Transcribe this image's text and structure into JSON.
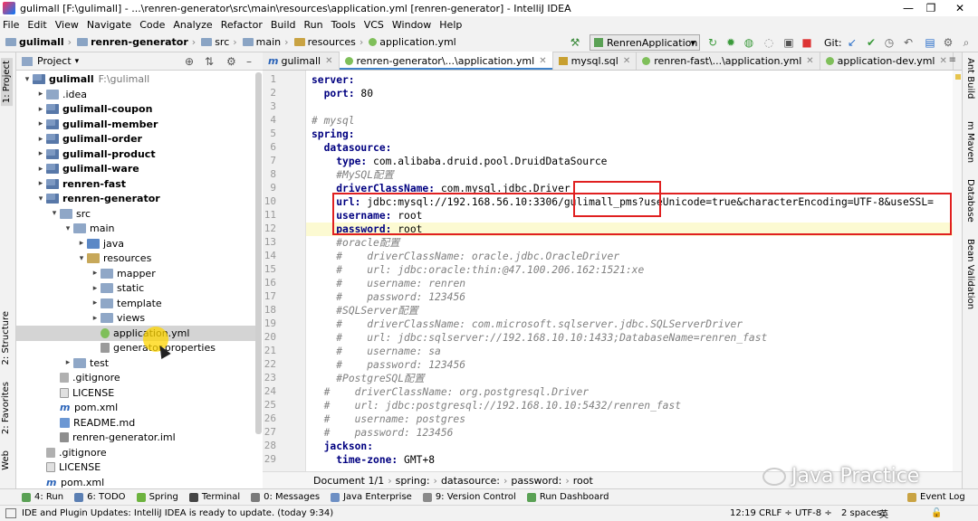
{
  "window": {
    "title": "gulimall [F:\\gulimall] - ...\\renren-generator\\src\\main\\resources\\application.yml [renren-generator] - IntelliJ IDEA",
    "controls": [
      "—",
      "❐",
      "✕"
    ]
  },
  "menu": [
    "File",
    "Edit",
    "View",
    "Navigate",
    "Code",
    "Analyze",
    "Refactor",
    "Build",
    "Run",
    "Tools",
    "VCS",
    "Window",
    "Help"
  ],
  "nav": {
    "crumbs": [
      "gulimall",
      "renren-generator",
      "src",
      "main",
      "resources",
      "application.yml"
    ],
    "run_config": "RenrenApplication",
    "git_label": "Git:"
  },
  "left_tabs": [
    "1: Project",
    "2: Structure",
    "2: Favorites",
    "Web"
  ],
  "right_tabs": [
    "Ant Build",
    "m Maven",
    "Database",
    "Bean Validation"
  ],
  "project": {
    "header": "Project",
    "tree": [
      {
        "label": "gulimall",
        "suffix": "F:\\gulimall",
        "depth": 0,
        "arrow": "▾",
        "icon": "mod",
        "bold": true
      },
      {
        "label": ".idea",
        "depth": 1,
        "arrow": "▸",
        "icon": "dir"
      },
      {
        "label": "gulimall-coupon",
        "depth": 1,
        "arrow": "▸",
        "icon": "mod",
        "bold": true
      },
      {
        "label": "gulimall-member",
        "depth": 1,
        "arrow": "▸",
        "icon": "mod",
        "bold": true
      },
      {
        "label": "gulimall-order",
        "depth": 1,
        "arrow": "▸",
        "icon": "mod",
        "bold": true
      },
      {
        "label": "gulimall-product",
        "depth": 1,
        "arrow": "▸",
        "icon": "mod",
        "bold": true
      },
      {
        "label": "gulimall-ware",
        "depth": 1,
        "arrow": "▸",
        "icon": "mod",
        "bold": true
      },
      {
        "label": "renren-fast",
        "depth": 1,
        "arrow": "▸",
        "icon": "mod",
        "bold": true
      },
      {
        "label": "renren-generator",
        "depth": 1,
        "arrow": "▾",
        "icon": "mod",
        "bold": true
      },
      {
        "label": "src",
        "depth": 2,
        "arrow": "▾",
        "icon": "dir"
      },
      {
        "label": "main",
        "depth": 3,
        "arrow": "▾",
        "icon": "dir"
      },
      {
        "label": "java",
        "depth": 4,
        "arrow": "▸",
        "icon": "srcd"
      },
      {
        "label": "resources",
        "depth": 4,
        "arrow": "▾",
        "icon": "resd"
      },
      {
        "label": "mapper",
        "depth": 5,
        "arrow": "▸",
        "icon": "dir"
      },
      {
        "label": "static",
        "depth": 5,
        "arrow": "▸",
        "icon": "dir"
      },
      {
        "label": "template",
        "depth": 5,
        "arrow": "▸",
        "icon": "dir"
      },
      {
        "label": "views",
        "depth": 5,
        "arrow": "▸",
        "icon": "dir"
      },
      {
        "label": "application.yml",
        "depth": 5,
        "arrow": "",
        "icon": "yml",
        "selected": true
      },
      {
        "label": "generator.properties",
        "depth": 5,
        "arrow": "",
        "icon": "prop"
      },
      {
        "label": "test",
        "depth": 3,
        "arrow": "▸",
        "icon": "dir"
      },
      {
        "label": ".gitignore",
        "depth": 2,
        "arrow": "",
        "icon": "git"
      },
      {
        "label": "LICENSE",
        "depth": 2,
        "arrow": "",
        "icon": "txt"
      },
      {
        "label": "pom.xml",
        "depth": 2,
        "arrow": "",
        "icon": "mvn"
      },
      {
        "label": "README.md",
        "depth": 2,
        "arrow": "",
        "icon": "md"
      },
      {
        "label": "renren-generator.iml",
        "depth": 2,
        "arrow": "",
        "icon": "iml"
      },
      {
        "label": ".gitignore",
        "depth": 1,
        "arrow": "",
        "icon": "git"
      },
      {
        "label": "LICENSE",
        "depth": 1,
        "arrow": "",
        "icon": "txt"
      },
      {
        "label": "pom.xml",
        "depth": 1,
        "arrow": "",
        "icon": "mvn"
      }
    ]
  },
  "editor_tabs": [
    {
      "label": "gulimall",
      "icon": "m",
      "active": false
    },
    {
      "label": "renren-generator\\...\\application.yml",
      "active": true
    },
    {
      "label": "mysql.sql",
      "active": false
    },
    {
      "label": "renren-fast\\...\\application.yml",
      "active": false
    },
    {
      "label": "application-dev.yml",
      "active": false
    }
  ],
  "editor": {
    "lines": [
      {
        "n": "1",
        "segs": [
          [
            "k",
            "server:"
          ]
        ]
      },
      {
        "n": "2",
        "segs": [
          [
            "v",
            "  "
          ],
          [
            "k",
            "port:"
          ],
          [
            "v",
            " 80"
          ]
        ]
      },
      {
        "n": "3",
        "segs": [
          [
            "v",
            ""
          ]
        ]
      },
      {
        "n": "4",
        "segs": [
          [
            "cm",
            "# mysql"
          ]
        ]
      },
      {
        "n": "5",
        "segs": [
          [
            "k",
            "spring:"
          ]
        ]
      },
      {
        "n": "6",
        "segs": [
          [
            "v",
            "  "
          ],
          [
            "k",
            "datasource:"
          ]
        ]
      },
      {
        "n": "7",
        "segs": [
          [
            "v",
            "    "
          ],
          [
            "k",
            "type:"
          ],
          [
            "v",
            " com.alibaba.druid.pool.DruidDataSource"
          ]
        ]
      },
      {
        "n": "8",
        "segs": [
          [
            "v",
            "    "
          ],
          [
            "cm",
            "#MySQL配置"
          ]
        ]
      },
      {
        "n": "9",
        "segs": [
          [
            "v",
            "    "
          ],
          [
            "k",
            "driverClassName:"
          ],
          [
            "v",
            " com.mysql.jdbc.Driver"
          ]
        ]
      },
      {
        "n": "10",
        "segs": [
          [
            "v",
            "    "
          ],
          [
            "k",
            "url:"
          ],
          [
            "v",
            " jdbc:mysql://192.168.56.10:3306/gulimall_pms?useUnicode=true&characterEncoding=UTF-8&useSSL="
          ]
        ]
      },
      {
        "n": "11",
        "segs": [
          [
            "v",
            "    "
          ],
          [
            "k",
            "username:"
          ],
          [
            "v",
            " root"
          ]
        ]
      },
      {
        "n": "12",
        "segs": [
          [
            "v",
            "    "
          ],
          [
            "k",
            "password:"
          ],
          [
            "v",
            " root"
          ]
        ],
        "hl": true
      },
      {
        "n": "13",
        "segs": [
          [
            "v",
            "    "
          ],
          [
            "cm",
            "#oracle配置"
          ]
        ]
      },
      {
        "n": "14",
        "segs": [
          [
            "v",
            "    "
          ],
          [
            "cm",
            "#    driverClassName: oracle.jdbc.OracleDriver"
          ]
        ]
      },
      {
        "n": "15",
        "segs": [
          [
            "v",
            "    "
          ],
          [
            "cm",
            "#    url: jdbc:oracle:thin:@47.100.206.162:1521:xe"
          ]
        ]
      },
      {
        "n": "16",
        "segs": [
          [
            "v",
            "    "
          ],
          [
            "cm",
            "#    username: renren"
          ]
        ]
      },
      {
        "n": "17",
        "segs": [
          [
            "v",
            "    "
          ],
          [
            "cm",
            "#    password: 123456"
          ]
        ]
      },
      {
        "n": "18",
        "segs": [
          [
            "v",
            "    "
          ],
          [
            "cm",
            "#SQLServer配置"
          ]
        ]
      },
      {
        "n": "19",
        "segs": [
          [
            "v",
            "    "
          ],
          [
            "cm",
            "#    driverClassName: com.microsoft.sqlserver.jdbc.SQLServerDriver"
          ]
        ]
      },
      {
        "n": "20",
        "segs": [
          [
            "v",
            "    "
          ],
          [
            "cm",
            "#    url: jdbc:sqlserver://192.168.10.10:1433;DatabaseName=renren_fast"
          ]
        ]
      },
      {
        "n": "21",
        "segs": [
          [
            "v",
            "    "
          ],
          [
            "cm",
            "#    username: sa"
          ]
        ]
      },
      {
        "n": "22",
        "segs": [
          [
            "v",
            "    "
          ],
          [
            "cm",
            "#    password: 123456"
          ]
        ]
      },
      {
        "n": "23",
        "segs": [
          [
            "v",
            "    "
          ],
          [
            "cm",
            "#PostgreSQL配置"
          ]
        ]
      },
      {
        "n": "24",
        "segs": [
          [
            "v",
            "  "
          ],
          [
            "cm",
            "#    driverClassName: org.postgresql.Driver"
          ]
        ]
      },
      {
        "n": "25",
        "segs": [
          [
            "v",
            "  "
          ],
          [
            "cm",
            "#    url: jdbc:postgresql://192.168.10.10:5432/renren_fast"
          ]
        ]
      },
      {
        "n": "26",
        "segs": [
          [
            "v",
            "  "
          ],
          [
            "cm",
            "#    username: postgres"
          ]
        ]
      },
      {
        "n": "27",
        "segs": [
          [
            "v",
            "  "
          ],
          [
            "cm",
            "#    password: 123456"
          ]
        ]
      },
      {
        "n": "28",
        "segs": [
          [
            "v",
            "  "
          ],
          [
            "k",
            "jackson:"
          ]
        ]
      },
      {
        "n": "29",
        "segs": [
          [
            "v",
            "    "
          ],
          [
            "k",
            "time-zone:"
          ],
          [
            "v",
            " GMT+8"
          ]
        ]
      }
    ],
    "breadcrumb": [
      "Document 1/1",
      "spring:",
      "datasource:",
      "password:",
      "root"
    ]
  },
  "tool_windows": [
    "4: Run",
    "6: TODO",
    "Spring",
    "Terminal",
    "0: Messages",
    "Java Enterprise",
    "9: Version Control",
    "Run Dashboard",
    "Event Log"
  ],
  "status": {
    "message": "IDE and Plugin Updates: IntelliJ IDEA is ready to update. (today 9:34)",
    "position": "12:19",
    "line_sep": "CRLF ÷",
    "encoding": "UTF-8 ÷",
    "indent": "2 spaces",
    "ime": "英"
  },
  "watermark": "Java Practice",
  "colors": {
    "selection": "#d4d4d4",
    "highlight_line": "#fcfad2",
    "annotation_box": "#e02020",
    "yaml_key": "#000080",
    "comment": "#808080"
  }
}
